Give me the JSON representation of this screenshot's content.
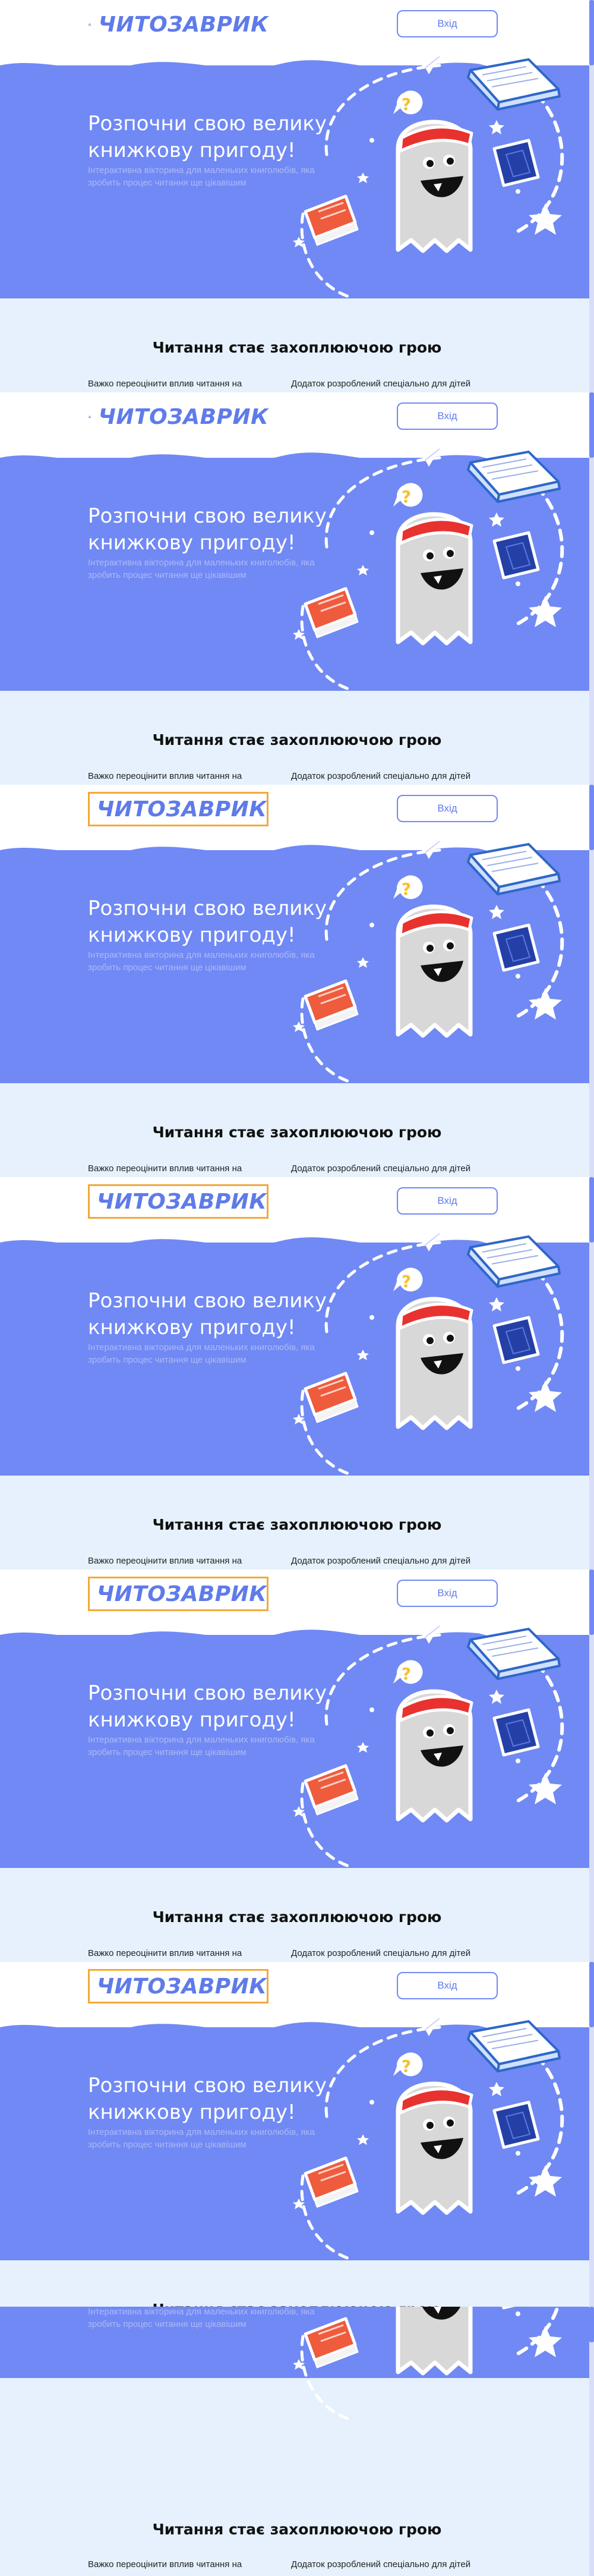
{
  "brand": {
    "name": "ЧИТОЗАВРИК"
  },
  "header": {
    "login_label": "Вхід"
  },
  "hero": {
    "title_line1": "Розпочни свою велику",
    "title_line2": "книжкову пригоду!",
    "subtitle_line1": "Інтерактивна вікторина для маленьких книголюбів, яка",
    "subtitle_line2": "зробить процес читання ще цікавішим"
  },
  "section": {
    "title": "Читання стає захоплюючою грою",
    "fact_left": "Важко переоцінити вплив читання на",
    "fact_right": "Додаток розроблений спеціально для дітей"
  },
  "illustration": {
    "icons": [
      "ghost-mascot-icon",
      "open-book-icon",
      "red-book-icon",
      "blue-book-icon",
      "question-bubble-icon",
      "paper-plane-icon",
      "star-icon"
    ]
  },
  "colors": {
    "hero_bg": "#7089f4",
    "page_bg": "#e6f1fd",
    "accent_orange": "#f2a93b",
    "book_red": "#ef5b3d",
    "book_blue": "#2440a6",
    "headband": "#e8322f",
    "question_yellow": "#f7c02b"
  }
}
